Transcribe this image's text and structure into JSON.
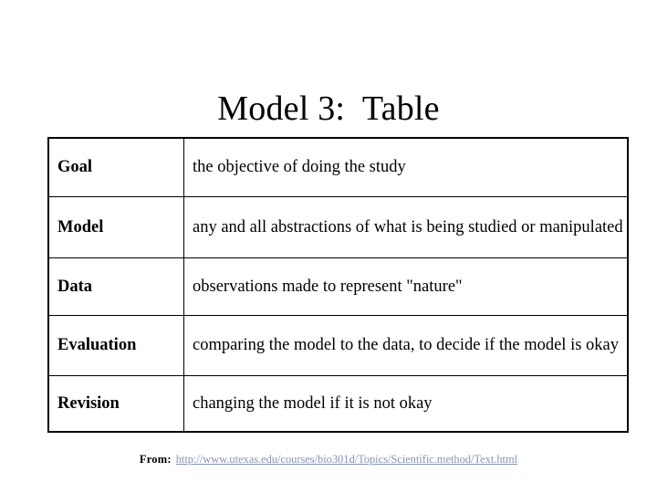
{
  "slide": {
    "title": "Model 3:  Table",
    "background_color": "#ffffff",
    "text_color": "#000000"
  },
  "table": {
    "border_color": "#000000",
    "columns": [
      "term",
      "definition"
    ],
    "rows": [
      {
        "term": "Goal",
        "definition": "the objective of doing the study"
      },
      {
        "term": "Model",
        "definition": "any and all abstractions of what is being studied or manipulated"
      },
      {
        "term": "Data",
        "definition": "observations made to represent \"nature\""
      },
      {
        "term": "Evaluation",
        "definition": "comparing the model to the data, to decide if the model is okay"
      },
      {
        "term": "Revision",
        "definition": "changing the model if it is not okay"
      }
    ]
  },
  "source": {
    "label": "From:",
    "url": "http://www.utexas.edu/courses/bio301d/Topics/Scientific.method/Text.html",
    "link_color": "#8a92b6"
  }
}
